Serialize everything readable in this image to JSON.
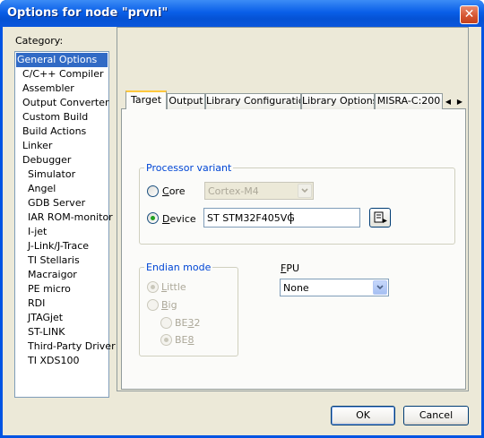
{
  "window": {
    "title": "Options for node \"prvni\"",
    "close_glyph": "✕"
  },
  "category": {
    "label": "Category:",
    "items": [
      {
        "label": "General Options",
        "level": 0,
        "selected": true
      },
      {
        "label": "C/C++ Compiler",
        "level": 1
      },
      {
        "label": "Assembler",
        "level": 1
      },
      {
        "label": "Output Converter",
        "level": 1
      },
      {
        "label": "Custom Build",
        "level": 1
      },
      {
        "label": "Build Actions",
        "level": 1
      },
      {
        "label": "Linker",
        "level": 1
      },
      {
        "label": "Debugger",
        "level": 1
      },
      {
        "label": "Simulator",
        "level": 2
      },
      {
        "label": "Angel",
        "level": 2
      },
      {
        "label": "GDB Server",
        "level": 2
      },
      {
        "label": "IAR ROM-monitor",
        "level": 2
      },
      {
        "label": "I-jet",
        "level": 2
      },
      {
        "label": "J-Link/J-Trace",
        "level": 2
      },
      {
        "label": "TI Stellaris",
        "level": 2
      },
      {
        "label": "Macraigor",
        "level": 2
      },
      {
        "label": "PE micro",
        "level": 2
      },
      {
        "label": "RDI",
        "level": 2
      },
      {
        "label": "JTAGjet",
        "level": 2
      },
      {
        "label": "ST-LINK",
        "level": 2
      },
      {
        "label": "Third-Party Driver",
        "level": 2
      },
      {
        "label": "TI XDS100",
        "level": 2
      }
    ]
  },
  "tabs": [
    {
      "label": "Target",
      "active": true
    },
    {
      "label": "Output"
    },
    {
      "label": "Library Configuration"
    },
    {
      "label": "Library Options"
    },
    {
      "label": "MISRA-C:200"
    }
  ],
  "processor_variant": {
    "legend": "Processor variant",
    "core": {
      "label_accel": "C",
      "label_rest": "ore",
      "value": "Cortex-M4",
      "checked": false
    },
    "device": {
      "label_accel": "D",
      "label_rest": "evice",
      "value": "ST STM32F405VG",
      "checked": true
    }
  },
  "endian_mode": {
    "legend": "Endian mode",
    "little": {
      "label_accel": "L",
      "label_rest": "ittle",
      "checked": true
    },
    "big": {
      "label_accel": "B",
      "label_rest": "ig",
      "checked": false
    },
    "be32": {
      "label_pre": "BE",
      "label_accel": "3",
      "label_rest": "2",
      "checked": false
    },
    "be8": {
      "label_pre": "BE",
      "label_accel": "8",
      "label_rest": "",
      "checked": true
    }
  },
  "fpu": {
    "label_accel": "F",
    "label_rest": "PU",
    "value": "None"
  },
  "buttons": {
    "ok": "OK",
    "cancel": "Cancel"
  },
  "colors": {
    "title_bar": "#0a5fe8",
    "selection": "#316ac5",
    "group_legend": "#0046d5",
    "dialog_bg": "#ece9d8"
  }
}
